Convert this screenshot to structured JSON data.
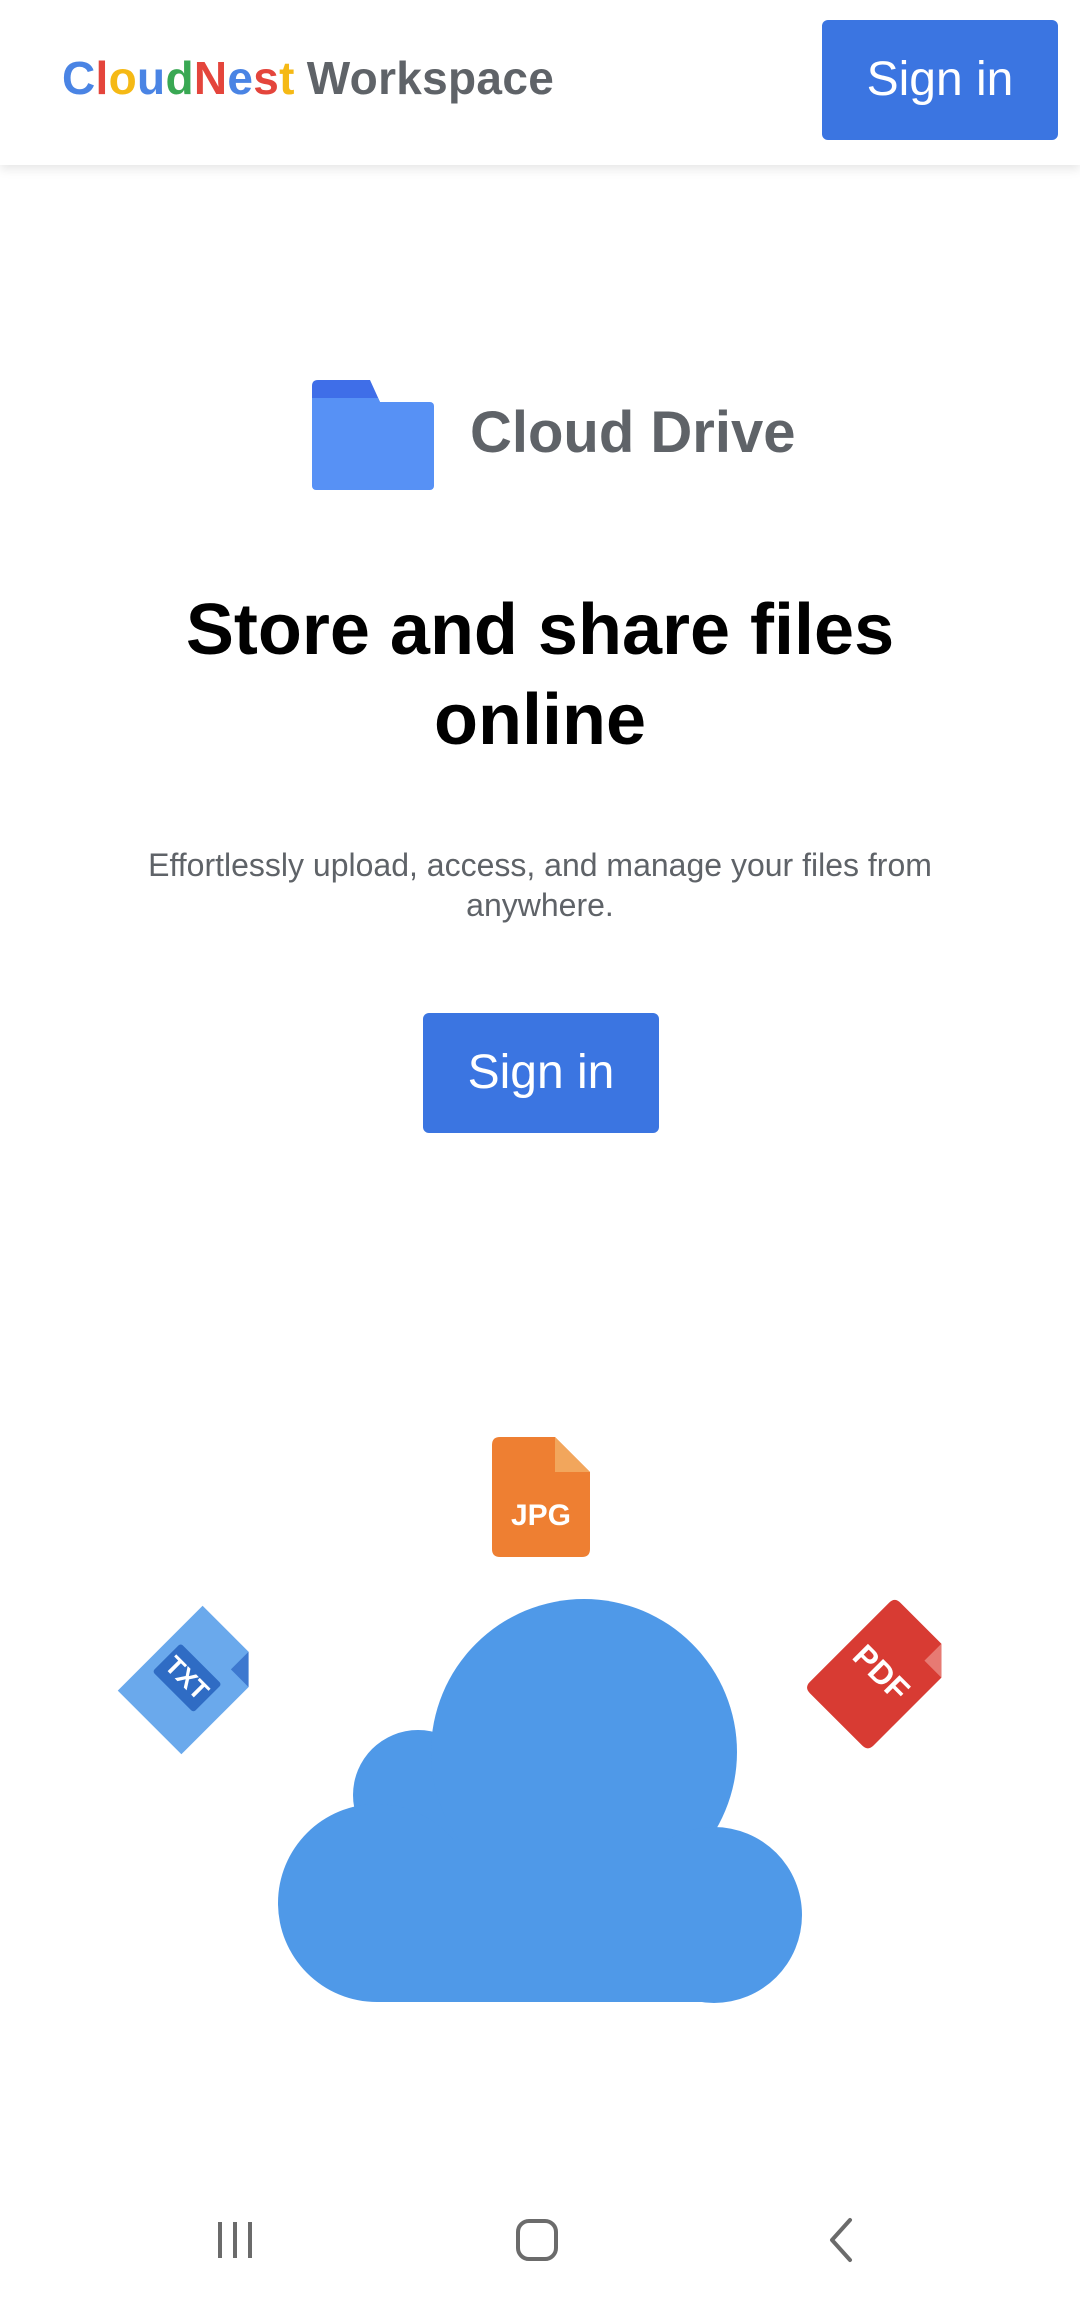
{
  "header": {
    "brand_letters": [
      {
        "char": "C",
        "color": "#4a84e4"
      },
      {
        "char": "l",
        "color": "#e4453c"
      },
      {
        "char": "o",
        "color": "#f5b915"
      },
      {
        "char": "u",
        "color": "#4a84e4"
      },
      {
        "char": "d",
        "color": "#39a853"
      },
      {
        "char": "N",
        "color": "#e4453c"
      },
      {
        "char": "e",
        "color": "#4a84e4"
      },
      {
        "char": "s",
        "color": "#e4453c"
      },
      {
        "char": "t",
        "color": "#f5b915"
      }
    ],
    "brand_suffix": "Workspace",
    "sign_in_label": "Sign in"
  },
  "product": {
    "icon": "folder-icon",
    "name": "Cloud Drive"
  },
  "hero": {
    "headline": "Store and share files online",
    "subtext": "Effortlessly upload, access, and manage your files from anywhere.",
    "sign_in_label": "Sign in"
  },
  "illustration": {
    "files": [
      {
        "icon": "txt-file-icon",
        "label": "TXT",
        "color": "#6aa9ec"
      },
      {
        "icon": "jpg-file-icon",
        "label": "JPG",
        "color": "#ee7f32"
      },
      {
        "icon": "pdf-file-icon",
        "label": "PDF",
        "color": "#d83b33"
      }
    ],
    "cloud_icon": "cloud-icon",
    "cloud_color": "#4f99e8"
  },
  "nav": {
    "recents_icon": "recent-apps-icon",
    "home_icon": "home-icon",
    "back_icon": "back-icon"
  },
  "colors": {
    "primary": "#3b75e1",
    "text_gray": "#5f6368"
  }
}
